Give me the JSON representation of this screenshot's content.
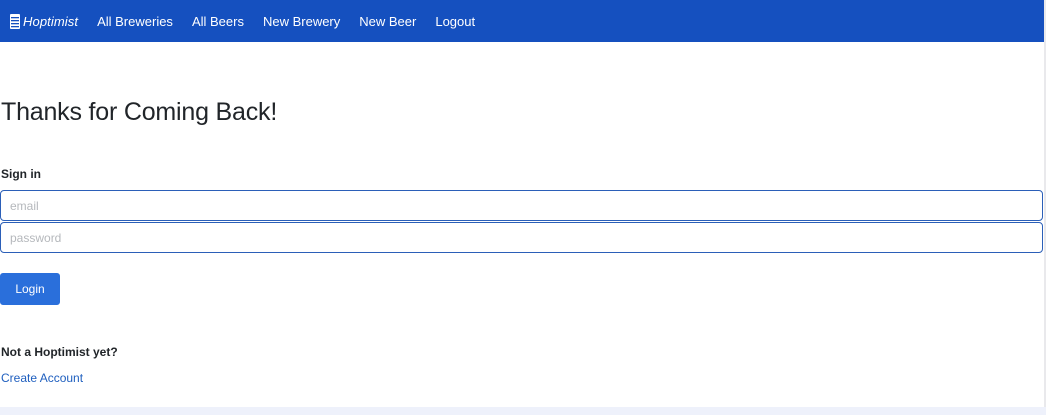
{
  "navbar": {
    "brand_icon": "beer-glass-icon",
    "brand": "Hoptimist",
    "links": [
      {
        "label": "All Breweries"
      },
      {
        "label": "All Beers"
      },
      {
        "label": "New Brewery"
      },
      {
        "label": "New Beer"
      },
      {
        "label": "Logout"
      }
    ],
    "background_color": "#1550bf"
  },
  "main": {
    "heading": "Thanks for Coming Back!",
    "form": {
      "title": "Sign in",
      "email_placeholder": "email",
      "password_placeholder": "password",
      "submit_label": "Login"
    },
    "signup": {
      "prompt": "Not a Hoptimist yet?",
      "link_label": "Create Account"
    }
  },
  "colors": {
    "primary_button": "#2a6fdb",
    "link": "#1f5fbf",
    "input_border": "#2b5fb8"
  }
}
